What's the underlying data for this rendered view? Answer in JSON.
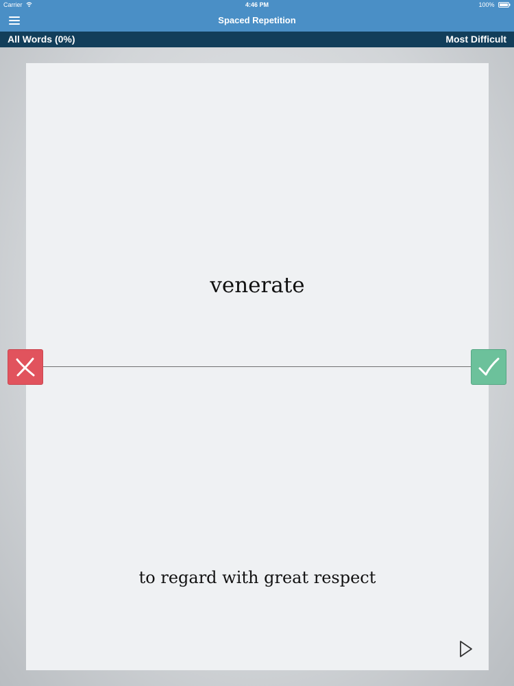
{
  "status_bar": {
    "carrier": "Carrier",
    "time": "4:46 PM",
    "battery": "100%"
  },
  "nav": {
    "title": "Spaced Repetition",
    "menu_icon": "hamburger-menu-icon"
  },
  "sub_bar": {
    "left_label": "All Words (0%)",
    "right_label": "Most Difficult"
  },
  "card": {
    "word": "venerate",
    "definition": "to regard with great respect"
  },
  "controls": {
    "wrong_icon": "x-icon",
    "right_icon": "checkmark-icon",
    "play_icon": "play-icon"
  },
  "colors": {
    "nav_background": "#4a8fc6",
    "sub_bar_background": "#123e5a",
    "wrong_button": "#e1535d",
    "right_button": "#6cc19b",
    "card_background": "#eff1f3"
  }
}
